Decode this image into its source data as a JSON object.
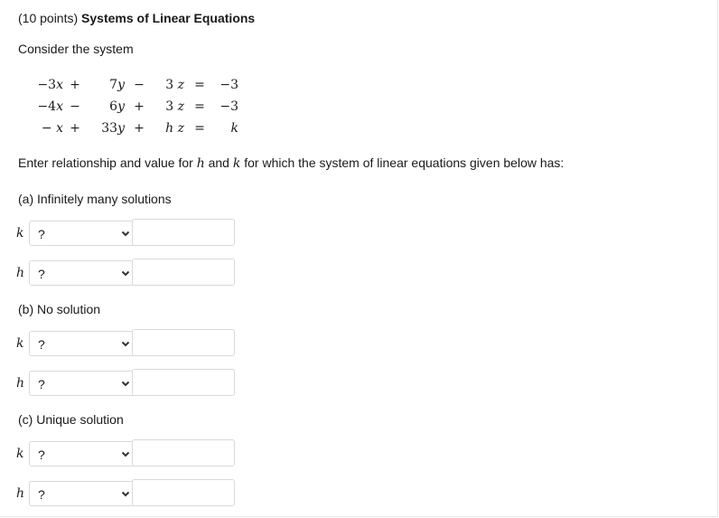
{
  "problem": {
    "title_points": "(10 points)",
    "title_text": "Systems of Linear Equations",
    "intro": "Consider the system"
  },
  "equations": [
    {
      "a": "−3",
      "av": "x",
      "op1": "+",
      "b": "7",
      "bv": "y",
      "op2": "−",
      "c": "3",
      "cv": "z",
      "eq": "=",
      "rhs": "−3"
    },
    {
      "a": "−4",
      "av": "x",
      "op1": "−",
      "b": "6",
      "bv": "y",
      "op2": "+",
      "c": "3",
      "cv": "z",
      "eq": "=",
      "rhs": "−3"
    },
    {
      "a": "−",
      "av": "x",
      "op1": "+",
      "b": "33",
      "bv": "y",
      "op2": "+",
      "c": "h",
      "cv": "z",
      "eq": "=",
      "rhs": "k"
    }
  ],
  "prompt": {
    "before": "Enter relationship and value for ",
    "h": "h",
    "mid": " and ",
    "k": "k",
    "after": " for which the system of linear equations given below has:"
  },
  "sections": {
    "a": "(a) Infinitely many solutions",
    "b": "(b) No solution",
    "c": "(c) Unique solution"
  },
  "rows": {
    "a_k": {
      "var": "k",
      "selected": "?",
      "value": ""
    },
    "a_h": {
      "var": "h",
      "selected": "?",
      "value": ""
    },
    "b_k": {
      "var": "k",
      "selected": "?",
      "value": ""
    },
    "b_h": {
      "var": "h",
      "selected": "?",
      "value": ""
    },
    "c_k": {
      "var": "k",
      "selected": "?",
      "value": ""
    },
    "c_h": {
      "var": "h",
      "selected": "?",
      "value": ""
    }
  },
  "icons": {
    "dropdown": "chevron-down-icon"
  },
  "colors": {
    "border": "#d9d9d9",
    "text": "#1a1a1a"
  }
}
